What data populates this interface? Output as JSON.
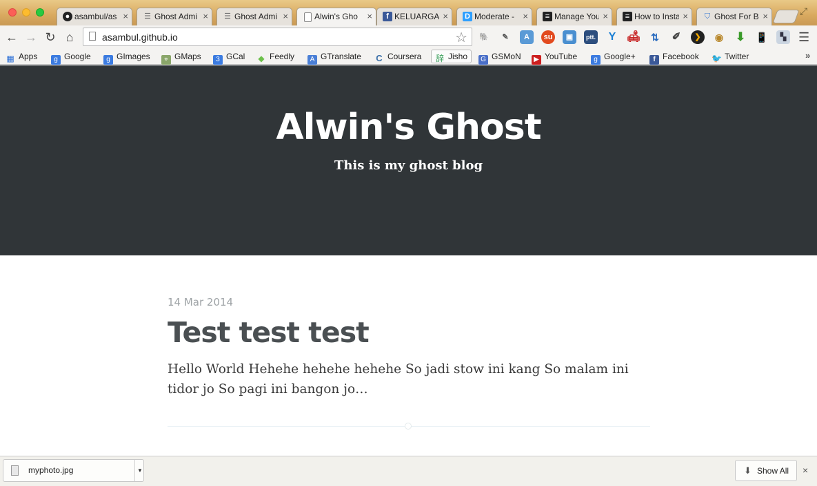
{
  "browser": {
    "tabs": [
      {
        "title": "asambul/as",
        "icon": "github-icon",
        "active": false
      },
      {
        "title": "Ghost Admi",
        "icon": "ghost-admin-icon",
        "active": false
      },
      {
        "title": "Ghost Admi",
        "icon": "ghost-admin-icon",
        "active": false
      },
      {
        "title": "Alwin's Gho",
        "icon": "page-icon",
        "active": true
      },
      {
        "title": "KELUARGA B",
        "icon": "facebook-icon",
        "active": false
      },
      {
        "title": "Moderate -",
        "icon": "disqus-icon",
        "active": false
      },
      {
        "title": "Manage You",
        "icon": "doc-icon",
        "active": false
      },
      {
        "title": "How to Insta",
        "icon": "doc-icon",
        "active": false
      },
      {
        "title": "Ghost For B",
        "icon": "shield-icon",
        "active": false
      }
    ],
    "tab_close_glyph": "×",
    "url": "asambul.github.io",
    "bookmarks": [
      {
        "label": "Apps",
        "icon": "apps-grid-icon",
        "color": "#2b6fd6"
      },
      {
        "label": "Google",
        "icon": "google-icon",
        "color": "#3b7be0"
      },
      {
        "label": "GImages",
        "icon": "google-icon",
        "color": "#3b7be0"
      },
      {
        "label": "GMaps",
        "icon": "maps-icon",
        "color": "#7a9a50"
      },
      {
        "label": "GCal",
        "icon": "calendar-icon",
        "color": "#3b7be0"
      },
      {
        "label": "Feedly",
        "icon": "feedly-icon",
        "color": "#6cc04a"
      },
      {
        "label": "GTranslate",
        "icon": "translate-icon",
        "color": "#4a7fd6"
      },
      {
        "label": "Coursera",
        "icon": "coursera-icon",
        "color": "#3a6fa8"
      },
      {
        "label": "Jisho",
        "icon": "jisho-icon",
        "color": "#3ba05c"
      },
      {
        "label": "GSMoN",
        "icon": "gsmon-icon",
        "color": "#4a6fc8"
      },
      {
        "label": "YouTube",
        "icon": "youtube-icon",
        "color": "#cc1f1f"
      },
      {
        "label": "Google+",
        "icon": "google-icon",
        "color": "#3b7be0"
      },
      {
        "label": "Facebook",
        "icon": "facebook-icon",
        "color": "#3b5998"
      },
      {
        "label": "Twitter",
        "icon": "twitter-icon",
        "color": "#3aa0e6"
      }
    ],
    "bookmarks_overflow": "»"
  },
  "blog": {
    "title": "Alwin's Ghost",
    "description": "This is my ghost blog",
    "header_color": "#303538",
    "posts": [
      {
        "date": "14 Mar 2014",
        "title": "Test test test",
        "excerpt": "Hello World Hehehe hehehe hehehe So jadi stow ini kang So malam ini tidor jo So pagi ini bangon jo…"
      }
    ]
  },
  "downloads": {
    "file_name": "myphoto.jpg",
    "show_all_label": "Show All",
    "close_glyph": "×"
  }
}
